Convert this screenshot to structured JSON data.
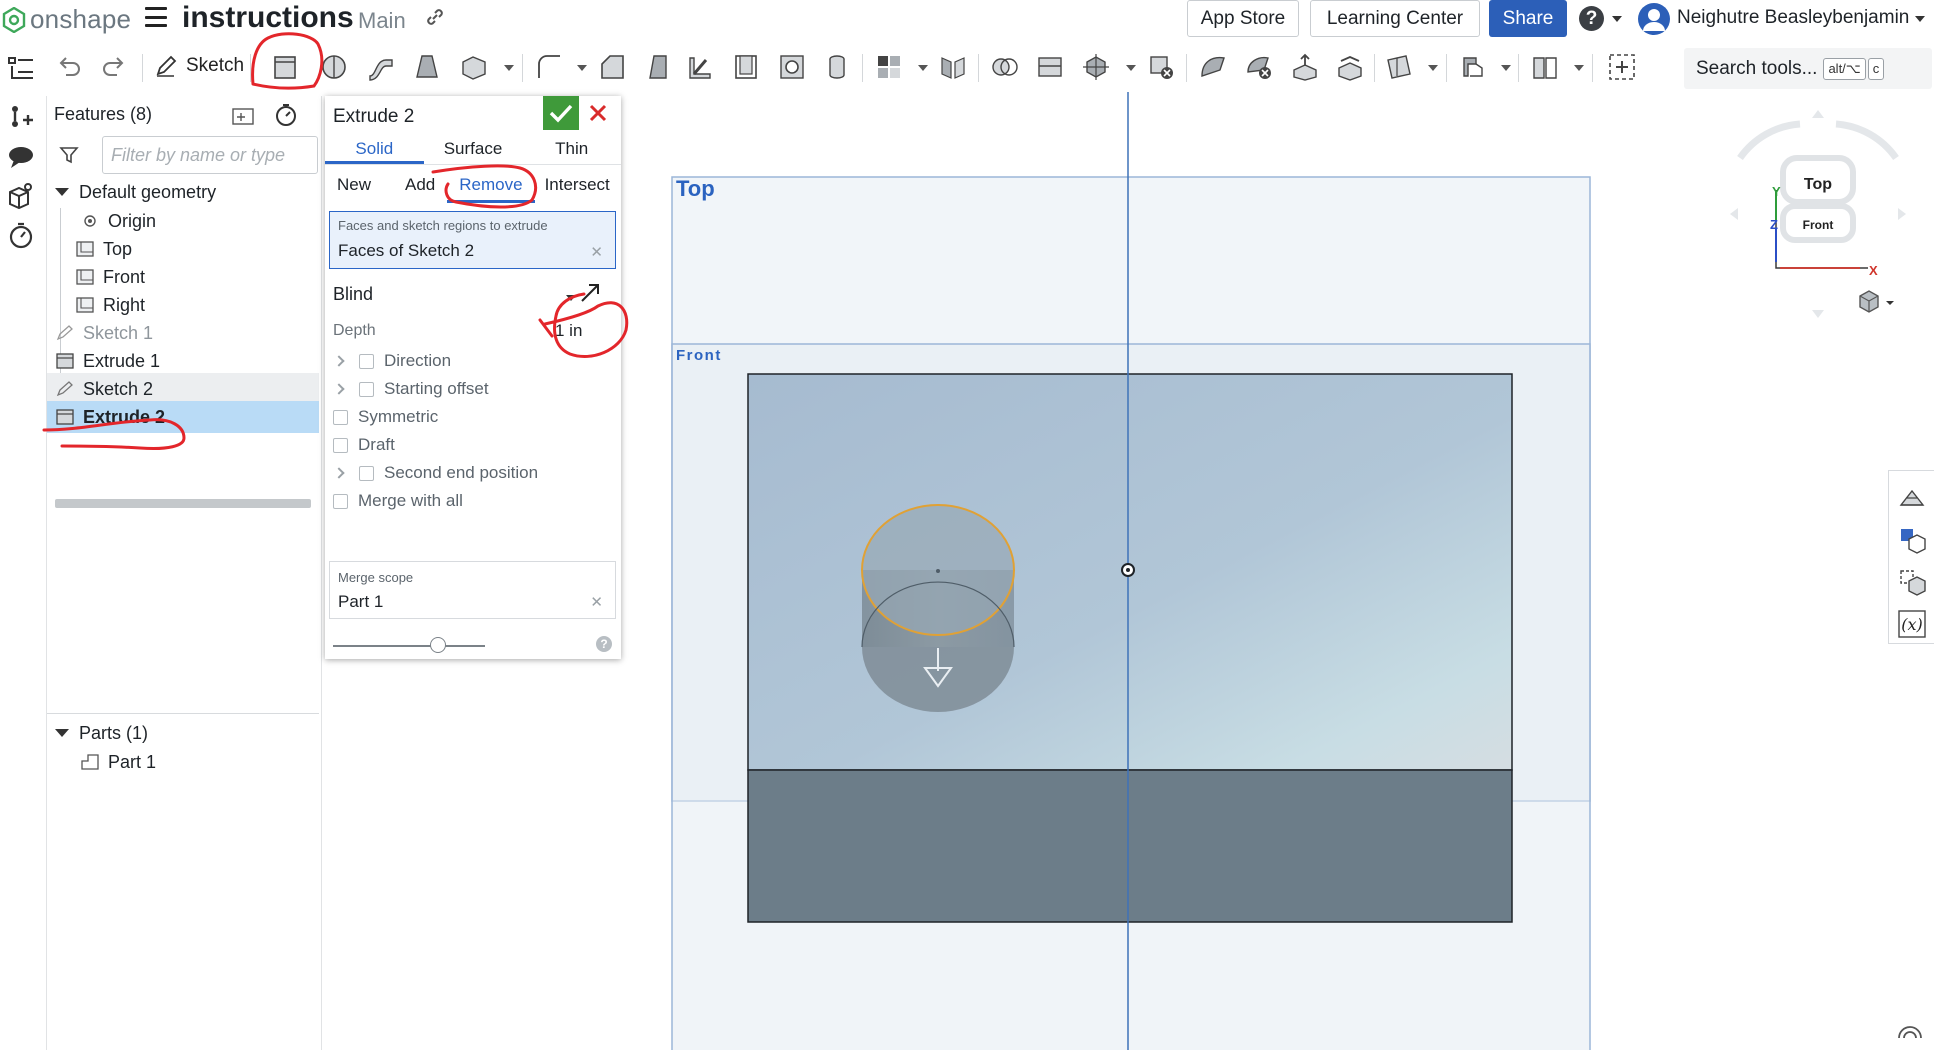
{
  "topbar": {
    "logo_text": "onshape",
    "doc_title": "instructions",
    "branch": "Main",
    "app_store": "App Store",
    "learning_center": "Learning Center",
    "share": "Share",
    "help": "?",
    "user_name": "Neighutre Beasleybenjamin"
  },
  "toolbar": {
    "sketch_label": "Sketch",
    "search_placeholder": "Search tools...",
    "search_kbd_1": "alt/⌥",
    "search_kbd_2": "c"
  },
  "tree": {
    "header": "Features (8)",
    "filter_placeholder": "Filter by name or type",
    "default_geometry": "Default geometry",
    "items": [
      {
        "label": "Origin"
      },
      {
        "label": "Top"
      },
      {
        "label": "Front"
      },
      {
        "label": "Right"
      },
      {
        "label": "Sketch 1"
      },
      {
        "label": "Extrude 1"
      },
      {
        "label": "Sketch 2"
      },
      {
        "label": "Extrude 2"
      }
    ],
    "parts_header": "Parts (1)",
    "part_item": "Part 1"
  },
  "dialog": {
    "title": "Extrude 2",
    "tabs": [
      "Solid",
      "Surface",
      "Thin"
    ],
    "active_tab": "Solid",
    "subtabs": [
      "New",
      "Add",
      "Remove",
      "Intersect"
    ],
    "active_subtab": "Remove",
    "faces_label": "Faces and sketch regions to extrude",
    "faces_value": "Faces of Sketch 2",
    "end_type": "Blind",
    "depth_label": "Depth",
    "depth_value": "1 in",
    "options": [
      "Direction",
      "Starting offset",
      "Symmetric",
      "Draft",
      "Second end position",
      "Merge with all"
    ],
    "merge_scope_label": "Merge scope",
    "merge_scope_value": "Part 1",
    "help": "?"
  },
  "viewport": {
    "plane_top": "Top",
    "plane_front": "Front",
    "cube_top": "Top",
    "cube_front": "Front",
    "axis_x": "X",
    "axis_y": "Y",
    "axis_z": "Z"
  },
  "colors": {
    "accent": "#2b66c7",
    "ok_green": "#3f9a3a",
    "close_red": "#d92b2b",
    "selected_row": "#b9dbf6",
    "part_face": "#a9bfd2",
    "part_side": "#6c7d89",
    "annotation_red": "#e3262b"
  }
}
